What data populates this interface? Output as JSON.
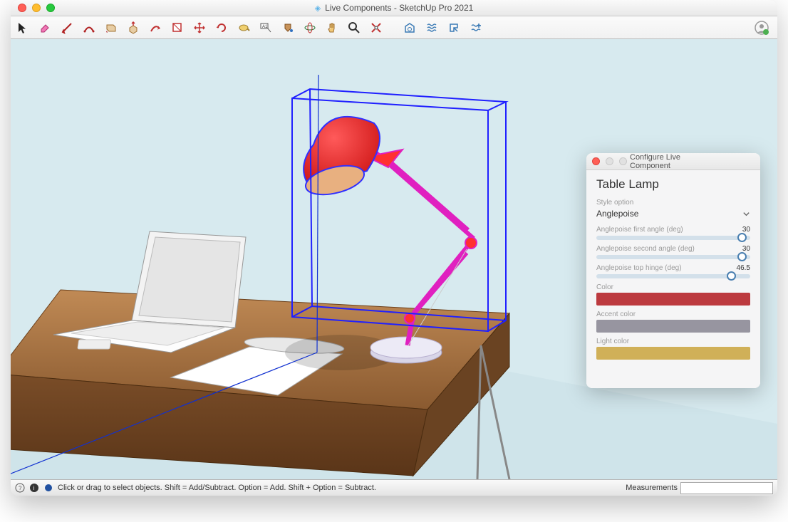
{
  "window": {
    "title": "Live Components - SketchUp Pro 2021"
  },
  "status": {
    "hint": "Click or drag to select objects. Shift = Add/Subtract. Option = Add. Shift + Option = Subtract.",
    "meas_label": "Measurements",
    "meas_value": ""
  },
  "panel": {
    "title": "Configure Live Component",
    "header": "Table Lamp",
    "style_label": "Style option",
    "style_value": "Anglepoise",
    "sliders": [
      {
        "label": "Anglepoise first angle (deg)",
        "value": "30",
        "thumb_pct": 95
      },
      {
        "label": "Anglepoise second angle (deg)",
        "value": "30",
        "thumb_pct": 95
      },
      {
        "label": "Anglepoise top hinge (deg)",
        "value": "46.5",
        "thumb_pct": 88
      }
    ],
    "colors": [
      {
        "label": "Color",
        "swatch": "#bc3a3f"
      },
      {
        "label": "Accent color",
        "swatch": "#9795a0"
      },
      {
        "label": "Light color",
        "swatch": "#d0b058"
      }
    ]
  }
}
